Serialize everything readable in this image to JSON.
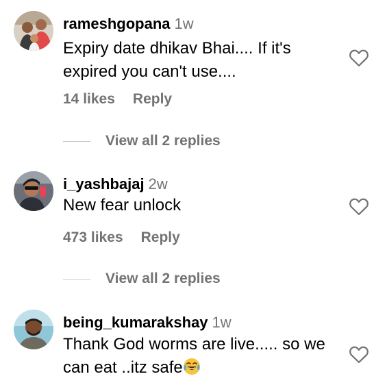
{
  "comments": [
    {
      "username": "rameshgopana",
      "time": "1w",
      "text": "Expiry date dhikav Bhai.... If it's expired you can't use....",
      "likes": "14 likes",
      "reply": "Reply",
      "view_replies": "View all 2 replies"
    },
    {
      "username": "i_yashbajaj",
      "time": "2w",
      "text": "New fear unlock",
      "likes": "473 likes",
      "reply": "Reply",
      "view_replies": "View all 2 replies"
    },
    {
      "username": "being_kumarakshay",
      "time": "1w",
      "text": "Thank God worms are live..... so we can eat ..itz safe",
      "emoji": "face-with-tears-of-joy"
    }
  ],
  "icons": {
    "like": "heart-outline-icon"
  },
  "colors": {
    "text": "#000000",
    "secondary": "#737373",
    "divider": "#c7c7c7"
  }
}
